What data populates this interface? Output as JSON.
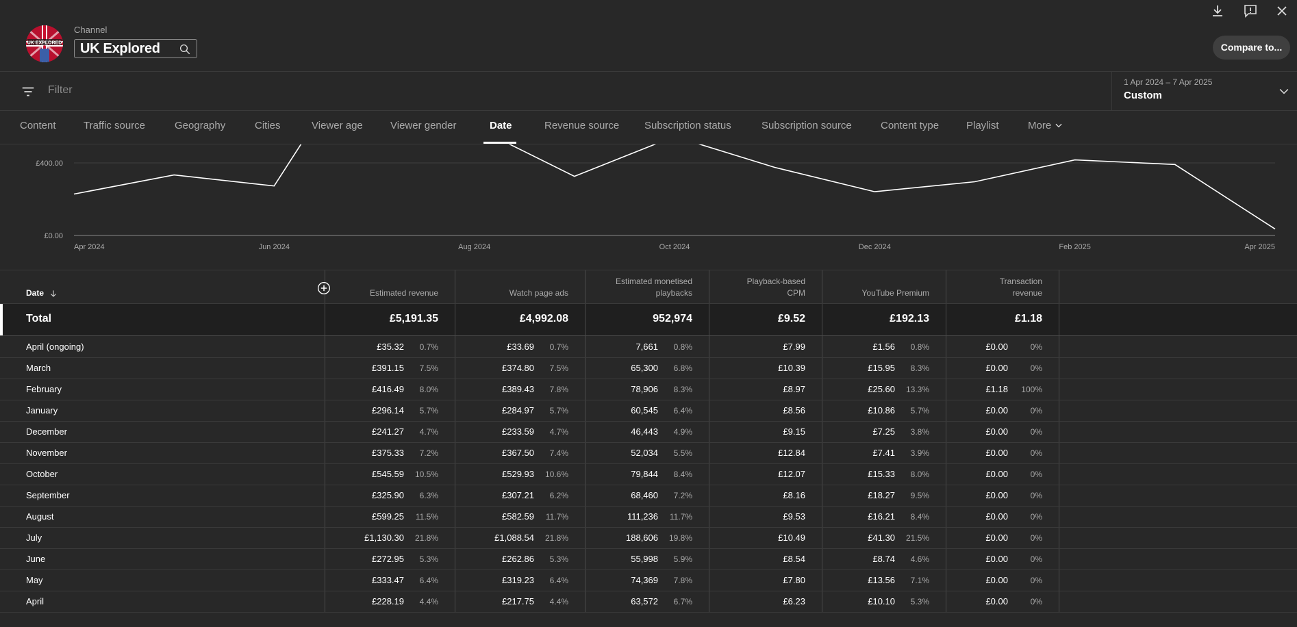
{
  "header": {
    "channel_label": "Channel",
    "channel_name": "UK Explored",
    "avatar_text": "UK EXPLORED",
    "compare_label": "Compare to..."
  },
  "filter": {
    "placeholder": "Filter"
  },
  "date_picker": {
    "range": "1 Apr 2024 – 7 Apr 2025",
    "preset": "Custom"
  },
  "tabs": [
    {
      "label": "Content",
      "active": false
    },
    {
      "label": "Traffic source",
      "active": false
    },
    {
      "label": "Geography",
      "active": false
    },
    {
      "label": "Cities",
      "active": false
    },
    {
      "label": "Viewer age",
      "active": false
    },
    {
      "label": "Viewer gender",
      "active": false
    },
    {
      "label": "Date",
      "active": true
    },
    {
      "label": "Revenue source",
      "active": false
    },
    {
      "label": "Subscription status",
      "active": false
    },
    {
      "label": "Subscription source",
      "active": false
    },
    {
      "label": "Content type",
      "active": false
    },
    {
      "label": "Playlist",
      "active": false
    },
    {
      "label": "More",
      "active": false
    }
  ],
  "chart_data": {
    "type": "line",
    "x": [
      "Apr 2024",
      "May 2024",
      "Jun 2024",
      "Jul 2024",
      "Aug 2024",
      "Sep 2024",
      "Oct 2024",
      "Nov 2024",
      "Dec 2024",
      "Jan 2025",
      "Feb 2025",
      "Mar 2025",
      "Apr 2025"
    ],
    "x_tick_labels": [
      "Apr 2024",
      "Jun 2024",
      "Aug 2024",
      "Oct 2024",
      "Dec 2024",
      "Feb 2025",
      "Apr 2025"
    ],
    "y_tick_labels": [
      "£400.00",
      "£0.00"
    ],
    "series": [
      {
        "values": [
          228.19,
          333.47,
          272.95,
          1130.3,
          599.25,
          325.9,
          545.59,
          375.33,
          241.27,
          296.14,
          416.49,
          391.15,
          35.32
        ]
      }
    ],
    "ylim_visible": [
      0,
      510
    ],
    "grid": true
  },
  "table": {
    "date_header": "Date",
    "columns": [
      {
        "label": [
          "Estimated revenue"
        ]
      },
      {
        "label": [
          "Watch page ads"
        ]
      },
      {
        "label": [
          "Estimated monetised",
          "playbacks"
        ]
      },
      {
        "label": [
          "Playback-based",
          "CPM"
        ]
      },
      {
        "label": [
          "YouTube Premium"
        ]
      },
      {
        "label": [
          "Transaction",
          "revenue"
        ]
      }
    ],
    "total": {
      "label": "Total",
      "values": [
        "£5,191.35",
        "£4,992.08",
        "952,974",
        "£9.52",
        "£192.13",
        "£1.18"
      ]
    },
    "rows": [
      {
        "label": "April (ongoing)",
        "values": [
          [
            "£35.32",
            "0.7%"
          ],
          [
            "£33.69",
            "0.7%"
          ],
          [
            "7,661",
            "0.8%"
          ],
          [
            "£7.99",
            ""
          ],
          [
            "£1.56",
            "0.8%"
          ],
          [
            "£0.00",
            "0%"
          ]
        ]
      },
      {
        "label": "March",
        "values": [
          [
            "£391.15",
            "7.5%"
          ],
          [
            "£374.80",
            "7.5%"
          ],
          [
            "65,300",
            "6.8%"
          ],
          [
            "£10.39",
            ""
          ],
          [
            "£15.95",
            "8.3%"
          ],
          [
            "£0.00",
            "0%"
          ]
        ]
      },
      {
        "label": "February",
        "values": [
          [
            "£416.49",
            "8.0%"
          ],
          [
            "£389.43",
            "7.8%"
          ],
          [
            "78,906",
            "8.3%"
          ],
          [
            "£8.97",
            ""
          ],
          [
            "£25.60",
            "13.3%"
          ],
          [
            "£1.18",
            "100%"
          ]
        ]
      },
      {
        "label": "January",
        "values": [
          [
            "£296.14",
            "5.7%"
          ],
          [
            "£284.97",
            "5.7%"
          ],
          [
            "60,545",
            "6.4%"
          ],
          [
            "£8.56",
            ""
          ],
          [
            "£10.86",
            "5.7%"
          ],
          [
            "£0.00",
            "0%"
          ]
        ]
      },
      {
        "label": "December",
        "values": [
          [
            "£241.27",
            "4.7%"
          ],
          [
            "£233.59",
            "4.7%"
          ],
          [
            "46,443",
            "4.9%"
          ],
          [
            "£9.15",
            ""
          ],
          [
            "£7.25",
            "3.8%"
          ],
          [
            "£0.00",
            "0%"
          ]
        ]
      },
      {
        "label": "November",
        "values": [
          [
            "£375.33",
            "7.2%"
          ],
          [
            "£367.50",
            "7.4%"
          ],
          [
            "52,034",
            "5.5%"
          ],
          [
            "£12.84",
            ""
          ],
          [
            "£7.41",
            "3.9%"
          ],
          [
            "£0.00",
            "0%"
          ]
        ]
      },
      {
        "label": "October",
        "values": [
          [
            "£545.59",
            "10.5%"
          ],
          [
            "£529.93",
            "10.6%"
          ],
          [
            "79,844",
            "8.4%"
          ],
          [
            "£12.07",
            ""
          ],
          [
            "£15.33",
            "8.0%"
          ],
          [
            "£0.00",
            "0%"
          ]
        ]
      },
      {
        "label": "September",
        "values": [
          [
            "£325.90",
            "6.3%"
          ],
          [
            "£307.21",
            "6.2%"
          ],
          [
            "68,460",
            "7.2%"
          ],
          [
            "£8.16",
            ""
          ],
          [
            "£18.27",
            "9.5%"
          ],
          [
            "£0.00",
            "0%"
          ]
        ]
      },
      {
        "label": "August",
        "values": [
          [
            "£599.25",
            "11.5%"
          ],
          [
            "£582.59",
            "11.7%"
          ],
          [
            "111,236",
            "11.7%"
          ],
          [
            "£9.53",
            ""
          ],
          [
            "£16.21",
            "8.4%"
          ],
          [
            "£0.00",
            "0%"
          ]
        ]
      },
      {
        "label": "July",
        "values": [
          [
            "£1,130.30",
            "21.8%"
          ],
          [
            "£1,088.54",
            "21.8%"
          ],
          [
            "188,606",
            "19.8%"
          ],
          [
            "£10.49",
            ""
          ],
          [
            "£41.30",
            "21.5%"
          ],
          [
            "£0.00",
            "0%"
          ]
        ]
      },
      {
        "label": "June",
        "values": [
          [
            "£272.95",
            "5.3%"
          ],
          [
            "£262.86",
            "5.3%"
          ],
          [
            "55,998",
            "5.9%"
          ],
          [
            "£8.54",
            ""
          ],
          [
            "£8.74",
            "4.6%"
          ],
          [
            "£0.00",
            "0%"
          ]
        ]
      },
      {
        "label": "May",
        "values": [
          [
            "£333.47",
            "6.4%"
          ],
          [
            "£319.23",
            "6.4%"
          ],
          [
            "74,369",
            "7.8%"
          ],
          [
            "£7.80",
            ""
          ],
          [
            "£13.56",
            "7.1%"
          ],
          [
            "£0.00",
            "0%"
          ]
        ]
      },
      {
        "label": "April",
        "values": [
          [
            "£228.19",
            "4.4%"
          ],
          [
            "£217.75",
            "4.4%"
          ],
          [
            "63,572",
            "6.7%"
          ],
          [
            "£6.23",
            ""
          ],
          [
            "£10.10",
            "5.3%"
          ],
          [
            "£0.00",
            "0%"
          ]
        ]
      }
    ]
  },
  "colors": {
    "background": "#282828",
    "line": "#ffffff",
    "muted_text": "#aaaaaa"
  },
  "icons": [
    "search-icon",
    "download-icon",
    "feedback-icon",
    "close-icon",
    "filter-icon",
    "chevron-down-icon",
    "add-column-icon",
    "sort-arrow-icon"
  ]
}
